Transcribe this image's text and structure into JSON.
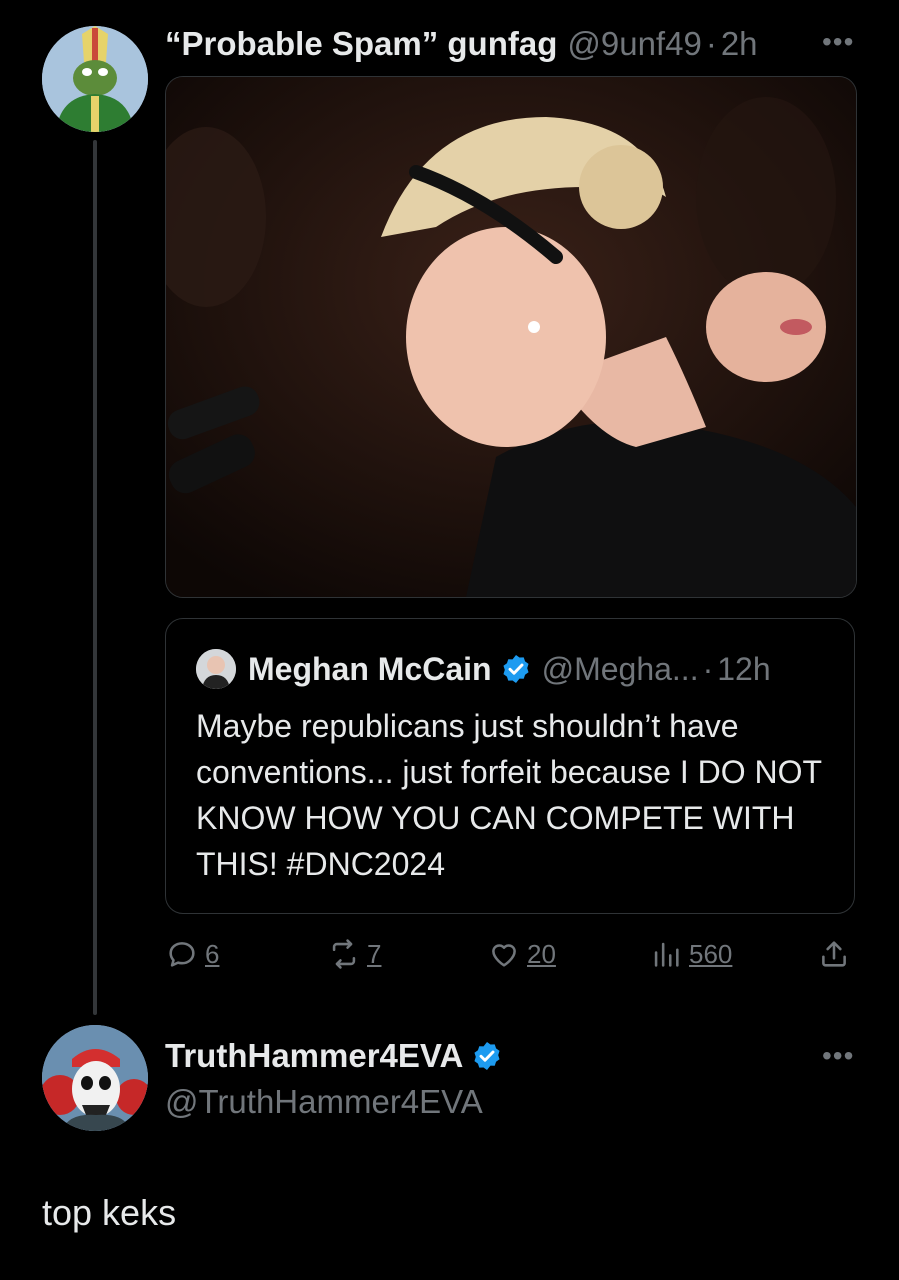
{
  "tweet": {
    "display_name": "“Probable Spam” gunfag",
    "handle": "@9unf49",
    "separator": "·",
    "time": "2h",
    "more_icon": "more-horizontal-icon",
    "media_description_icon": "photo",
    "quote": {
      "display_name": "Meghan McCain",
      "handle": "@Megha...",
      "separator": "·",
      "time": "12h",
      "text": "Maybe republicans just shouldn’t have conventions... just forfeit because I DO NOT KNOW HOW YOU CAN COMPETE WITH THIS! #DNC2024"
    },
    "actions": {
      "replies": "6",
      "reposts": "7",
      "likes": "20",
      "views": "560"
    }
  },
  "reply": {
    "display_name": "TruthHammer4EVA",
    "handle": "@TruthHammer4EVA",
    "text": "top keks"
  },
  "colors": {
    "background": "#000000",
    "text": "#e7e9ea",
    "muted": "#71767b",
    "verified": "#1d9bf0",
    "border": "#2f3336"
  }
}
